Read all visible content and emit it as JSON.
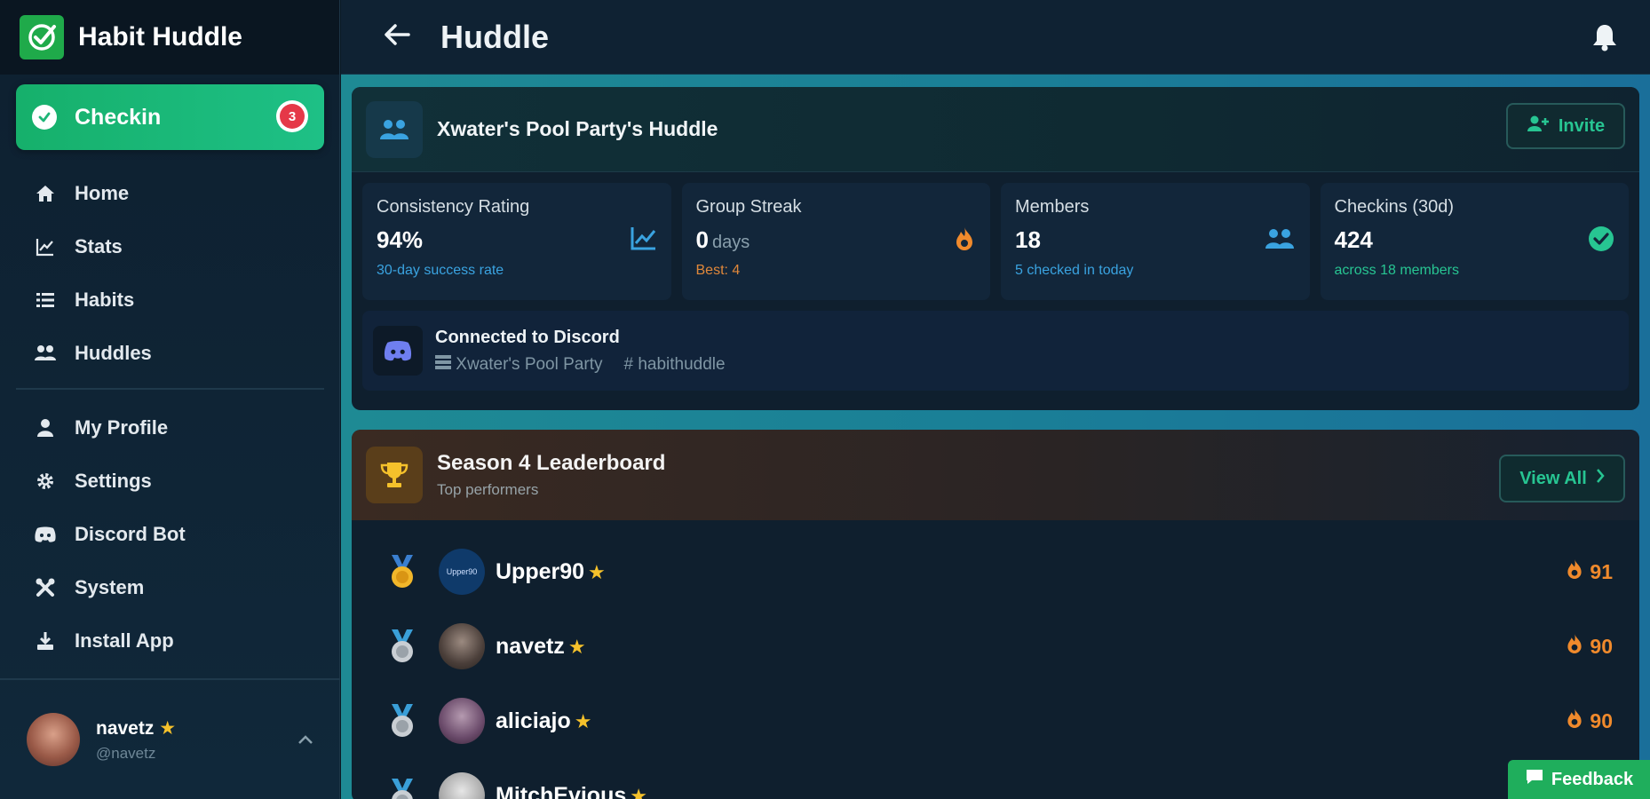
{
  "app": {
    "name": "Habit Huddle"
  },
  "checkin": {
    "label": "Checkin",
    "badge": "3"
  },
  "nav": {
    "primary": [
      {
        "label": "Home",
        "icon": "home-icon"
      },
      {
        "label": "Stats",
        "icon": "chart-icon"
      },
      {
        "label": "Habits",
        "icon": "list-icon"
      },
      {
        "label": "Huddles",
        "icon": "users-icon"
      }
    ],
    "secondary": [
      {
        "label": "My Profile",
        "icon": "user-icon"
      },
      {
        "label": "Settings",
        "icon": "gear-icon"
      },
      {
        "label": "Discord Bot",
        "icon": "discord-icon"
      },
      {
        "label": "System",
        "icon": "tools-icon"
      },
      {
        "label": "Install App",
        "icon": "download-icon"
      }
    ]
  },
  "profile": {
    "name": "navetz",
    "handle": "@navetz"
  },
  "header": {
    "title": "Huddle"
  },
  "huddle": {
    "name": "Xwater's Pool Party's Huddle",
    "invite_label": "Invite",
    "stats": [
      {
        "label": "Consistency Rating",
        "value": "94%",
        "unit": "",
        "sub": "30-day success rate",
        "sub_color": "#3aa3e0",
        "icon": "trend-icon"
      },
      {
        "label": "Group Streak",
        "value": "0",
        "unit": "days",
        "sub": "Best: 4",
        "sub_color": "#e0883a",
        "icon": "flame-icon"
      },
      {
        "label": "Members",
        "value": "18",
        "unit": "",
        "sub": "5 checked in today",
        "sub_color": "#3aa3e0",
        "icon": "users-icon"
      },
      {
        "label": "Checkins (30d)",
        "value": "424",
        "unit": "",
        "sub": "across 18 members",
        "sub_color": "#27c592",
        "icon": "check-circle-icon"
      }
    ],
    "discord": {
      "title": "Connected to Discord",
      "server": "Xwater's Pool Party",
      "channel": "habithuddle"
    }
  },
  "leaderboard": {
    "title": "Season 4 Leaderboard",
    "subtitle": "Top performers",
    "view_all_label": "View All",
    "rows": [
      {
        "name": "Upper90",
        "score": "91",
        "medal": "gold",
        "avatar_text": "Upper90"
      },
      {
        "name": "navetz",
        "score": "90",
        "medal": "silver",
        "avatar_text": ""
      },
      {
        "name": "aliciajo",
        "score": "90",
        "medal": "silver",
        "avatar_text": ""
      },
      {
        "name": "MitchEvious",
        "score": "",
        "medal": "silver",
        "avatar_text": ""
      }
    ]
  },
  "feedback": {
    "label": "Feedback"
  },
  "colors": {
    "accent": "#27c592",
    "flame": "#f08a2c",
    "star": "#f5c12b",
    "badge": "#e53848"
  }
}
